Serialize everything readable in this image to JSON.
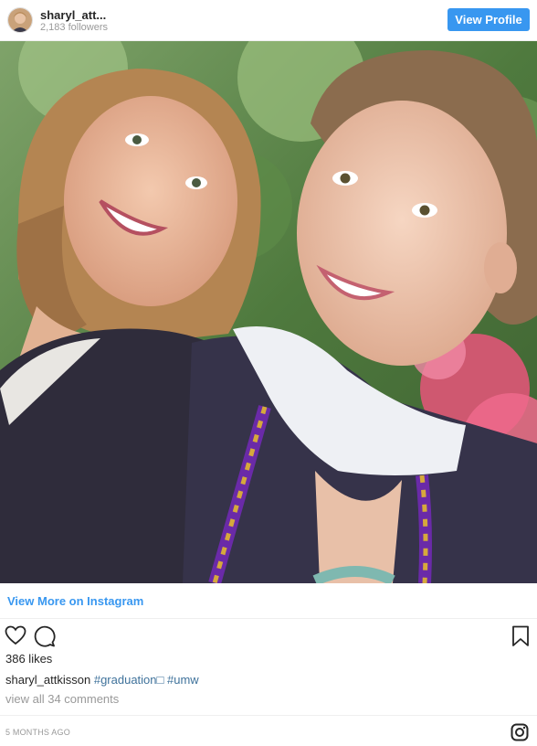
{
  "header": {
    "username": "sharyl_att...",
    "followers": "2,183 followers",
    "view_profile_label": "View Profile"
  },
  "photo": {
    "icon": "selfie-photo"
  },
  "links": {
    "view_more": "View More on Instagram"
  },
  "actions": {
    "like_icon": "heart-icon",
    "comment_icon": "comment-icon",
    "save_icon": "bookmark-icon"
  },
  "stats": {
    "likes": "386 likes"
  },
  "caption": {
    "username": "sharyl_attkisson",
    "hashtag_1": "#graduation□",
    "hashtag_2": "#umw"
  },
  "comments": {
    "view_all": "view all 34 comments"
  },
  "footer": {
    "timestamp": "5 MONTHS AGO",
    "instagram_icon": "instagram-icon"
  },
  "colors": {
    "accent": "#3897f0",
    "hashtag": "#3f729b",
    "muted": "#999999"
  }
}
